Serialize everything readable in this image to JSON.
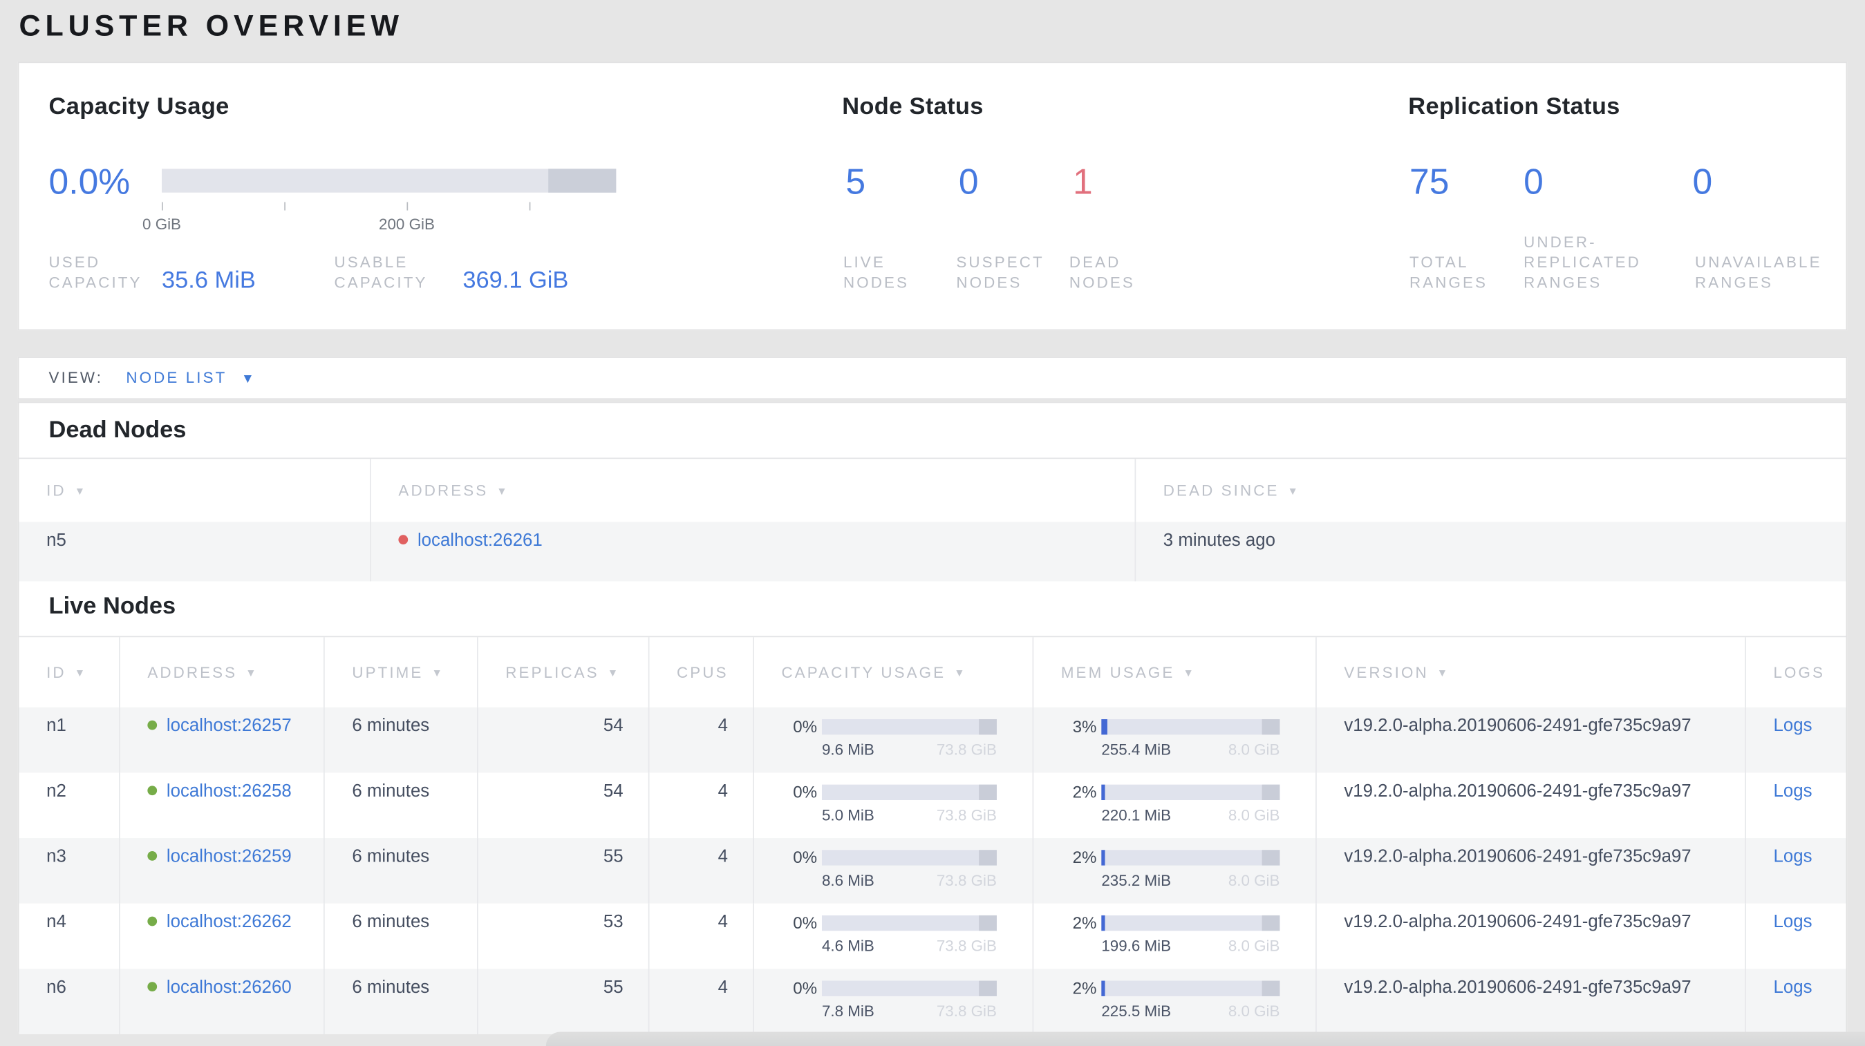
{
  "page_title": "CLUSTER OVERVIEW",
  "summary": {
    "capacity": {
      "title": "Capacity Usage",
      "percent": "0.0%",
      "tick_labels": [
        "0 GiB",
        "200 GiB"
      ],
      "used_label": "USED CAPACITY",
      "used_value": "35.6 MiB",
      "usable_label": "USABLE CAPACITY",
      "usable_value": "369.1 GiB"
    },
    "nodes": {
      "title": "Node Status",
      "live": {
        "value": "5",
        "label": "LIVE NODES"
      },
      "suspect": {
        "value": "0",
        "label": "SUSPECT NODES"
      },
      "dead": {
        "value": "1",
        "label": "DEAD NODES"
      }
    },
    "replication": {
      "title": "Replication Status",
      "total": {
        "value": "75",
        "label": "TOTAL RANGES"
      },
      "under": {
        "value": "0",
        "label": "UNDER-REPLICATED RANGES"
      },
      "unavailable": {
        "value": "0",
        "label": "UNAVAILABLE RANGES"
      }
    }
  },
  "view_bar": {
    "label": "VIEW:",
    "selected": "NODE LIST",
    "caret": "▼"
  },
  "dead_nodes": {
    "title": "Dead Nodes",
    "headers": [
      "ID",
      "ADDRESS",
      "DEAD SINCE"
    ],
    "sort_arrow": "▼",
    "rows": [
      {
        "id": "n5",
        "address": "localhost:26261",
        "dead_since": "3 minutes ago"
      }
    ]
  },
  "live_nodes": {
    "title": "Live Nodes",
    "headers": [
      "ID",
      "ADDRESS",
      "UPTIME",
      "REPLICAS",
      "CPUS",
      "CAPACITY USAGE",
      "MEM USAGE",
      "VERSION",
      "LOGS"
    ],
    "rows": [
      {
        "id": "n1",
        "address": "localhost:26257",
        "uptime": "6 minutes",
        "replicas": "54",
        "cpus": "4",
        "capacity": {
          "pct": "0%",
          "pct_num": 0,
          "used": "9.6 MiB",
          "total": "73.8 GiB"
        },
        "memory": {
          "pct": "3%",
          "pct_num": 3,
          "used": "255.4 MiB",
          "total": "8.0 GiB"
        },
        "version": "v19.2.0-alpha.20190606-2491-gfe735c9a97",
        "logs": "Logs"
      },
      {
        "id": "n2",
        "address": "localhost:26258",
        "uptime": "6 minutes",
        "replicas": "54",
        "cpus": "4",
        "capacity": {
          "pct": "0%",
          "pct_num": 0,
          "used": "5.0 MiB",
          "total": "73.8 GiB"
        },
        "memory": {
          "pct": "2%",
          "pct_num": 2,
          "used": "220.1 MiB",
          "total": "8.0 GiB"
        },
        "version": "v19.2.0-alpha.20190606-2491-gfe735c9a97",
        "logs": "Logs"
      },
      {
        "id": "n3",
        "address": "localhost:26259",
        "uptime": "6 minutes",
        "replicas": "55",
        "cpus": "4",
        "capacity": {
          "pct": "0%",
          "pct_num": 0,
          "used": "8.6 MiB",
          "total": "73.8 GiB"
        },
        "memory": {
          "pct": "2%",
          "pct_num": 2,
          "used": "235.2 MiB",
          "total": "8.0 GiB"
        },
        "version": "v19.2.0-alpha.20190606-2491-gfe735c9a97",
        "logs": "Logs"
      },
      {
        "id": "n4",
        "address": "localhost:26262",
        "uptime": "6 minutes",
        "replicas": "53",
        "cpus": "4",
        "capacity": {
          "pct": "0%",
          "pct_num": 0,
          "used": "4.6 MiB",
          "total": "73.8 GiB"
        },
        "memory": {
          "pct": "2%",
          "pct_num": 2,
          "used": "199.6 MiB",
          "total": "8.0 GiB"
        },
        "version": "v19.2.0-alpha.20190606-2491-gfe735c9a97",
        "logs": "Logs"
      },
      {
        "id": "n6",
        "address": "localhost:26260",
        "uptime": "6 minutes",
        "replicas": "55",
        "cpus": "4",
        "capacity": {
          "pct": "0%",
          "pct_num": 0,
          "used": "7.8 MiB",
          "total": "73.8 GiB"
        },
        "memory": {
          "pct": "2%",
          "pct_num": 2,
          "used": "225.5 MiB",
          "total": "8.0 GiB"
        },
        "version": "v19.2.0-alpha.20190606-2491-gfe735c9a97",
        "logs": "Logs"
      }
    ]
  }
}
